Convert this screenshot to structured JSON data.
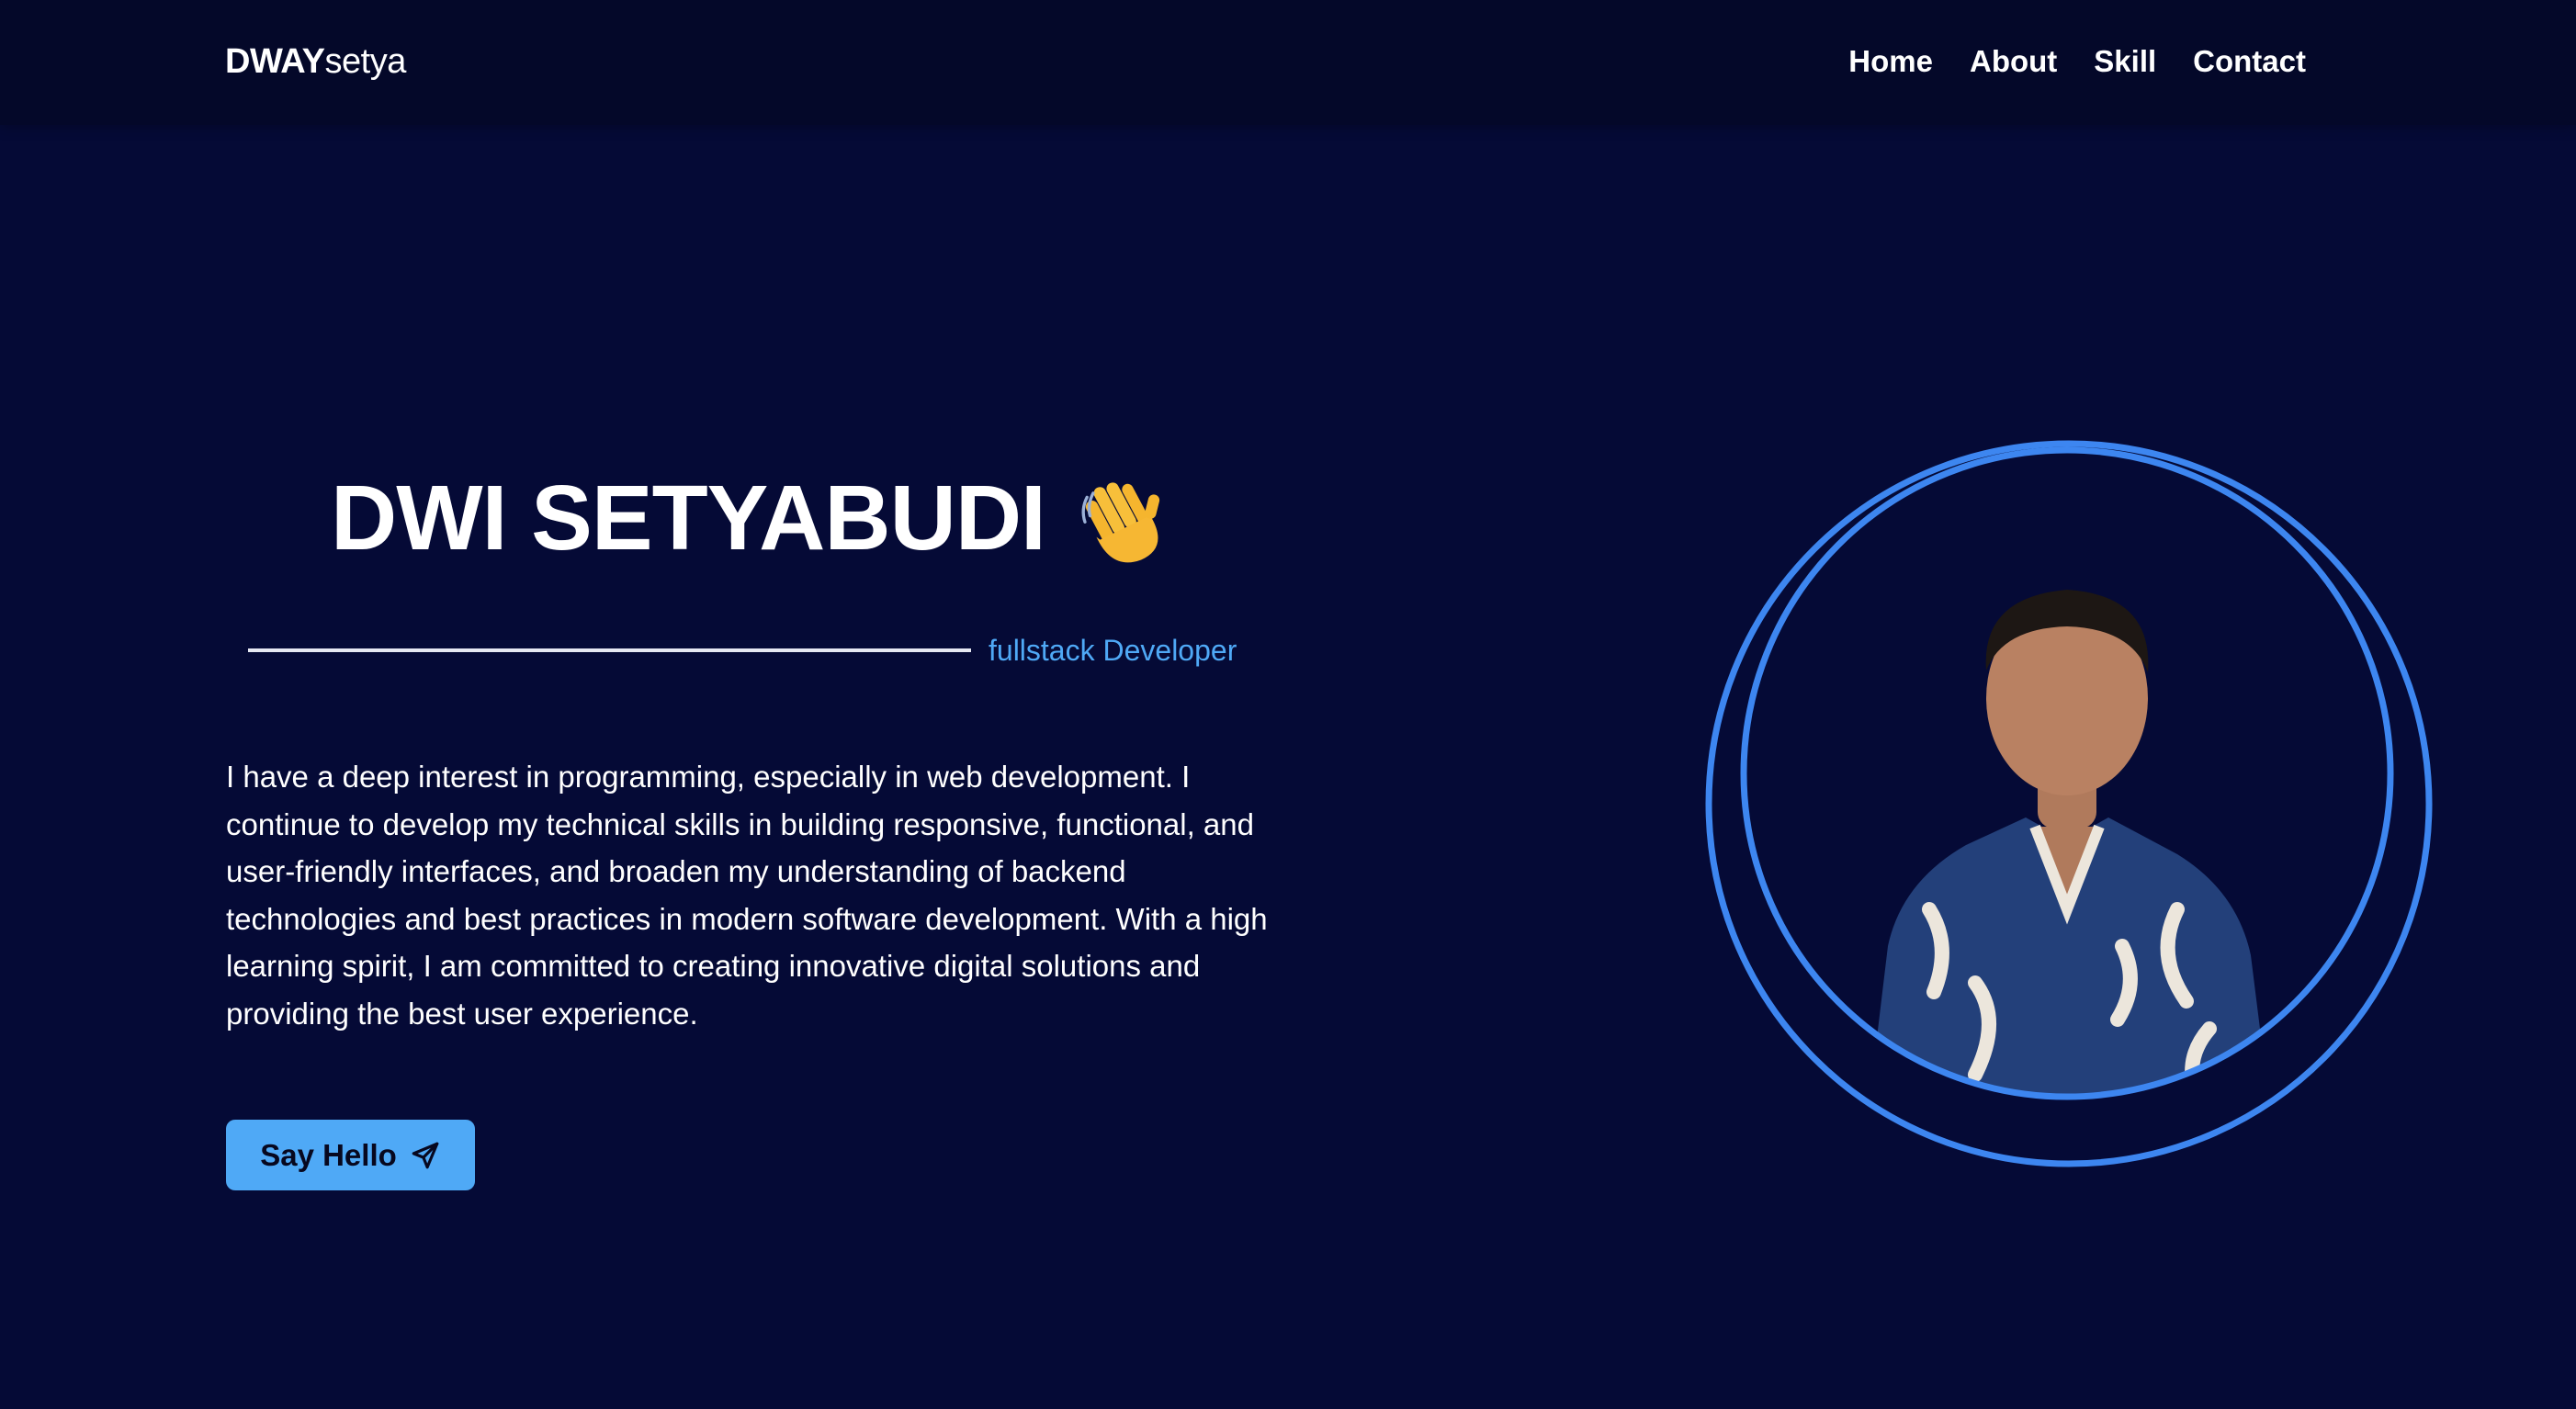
{
  "brand": {
    "strong": "DWAY",
    "light": "setya"
  },
  "nav": {
    "items": [
      {
        "label": "Home"
      },
      {
        "label": "About"
      },
      {
        "label": "Skill"
      },
      {
        "label": "Contact"
      }
    ]
  },
  "hero": {
    "title": "DWI SETYABUDI",
    "wave_icon": "waving-hand-icon",
    "role": "fullstack Developer",
    "bio": "I have a deep interest in programming, especially in web development. I continue to develop my technical skills in building responsive, functional, and user-friendly interfaces, and broaden my understanding of backend technologies and best practices in modern software development. With a high learning spirit, I am committed to creating innovative digital solutions and providing the best user experience.",
    "cta_label": "Say Hello",
    "cta_icon": "send-icon"
  },
  "colors": {
    "background": "#050a36",
    "navbar": "#040829",
    "accent": "#4fa9f6",
    "ring": "#3d86f0",
    "text": "#ffffff"
  }
}
